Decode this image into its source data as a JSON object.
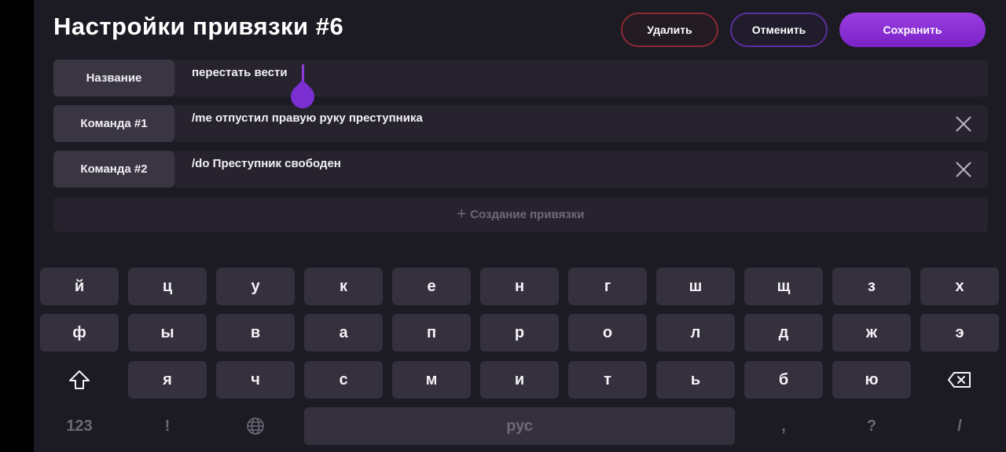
{
  "header": {
    "title": "Настройки привязки #6",
    "delete_label": "Удалить",
    "cancel_label": "Отменить",
    "save_label": "Сохранить"
  },
  "rows": [
    {
      "label": "Название",
      "value": "перестать вести",
      "removable": false
    },
    {
      "label": "Команда #1",
      "value": "/me отпустил правую руку преступника",
      "removable": true
    },
    {
      "label": "Команда #2",
      "value": "/do Преступник свободен",
      "removable": true
    }
  ],
  "create_binding": {
    "plus": "+",
    "label": "Создание привязки"
  },
  "keyboard": {
    "row1": [
      "й",
      "ц",
      "у",
      "к",
      "е",
      "н",
      "г",
      "ш",
      "щ",
      "з",
      "х"
    ],
    "row2": [
      "ф",
      "ы",
      "в",
      "а",
      "п",
      "р",
      "о",
      "л",
      "д",
      "ж",
      "э"
    ],
    "row3": [
      "я",
      "ч",
      "с",
      "м",
      "и",
      "т",
      "ь",
      "б",
      "ю"
    ],
    "numbers_key": "123",
    "exclaim_key": "!",
    "space_label": "рус",
    "comma_key": ",",
    "question_key": "?",
    "slash_key": "/",
    "icons": {
      "shift": "shift-icon",
      "backspace": "backspace-icon",
      "language": "globe-icon"
    }
  },
  "colors": {
    "background": "#1c1a22",
    "accent": "#8f3ad8",
    "delete_border": "#8a2a35",
    "cancel_border": "#5a2fa0",
    "key": "#35303d"
  }
}
